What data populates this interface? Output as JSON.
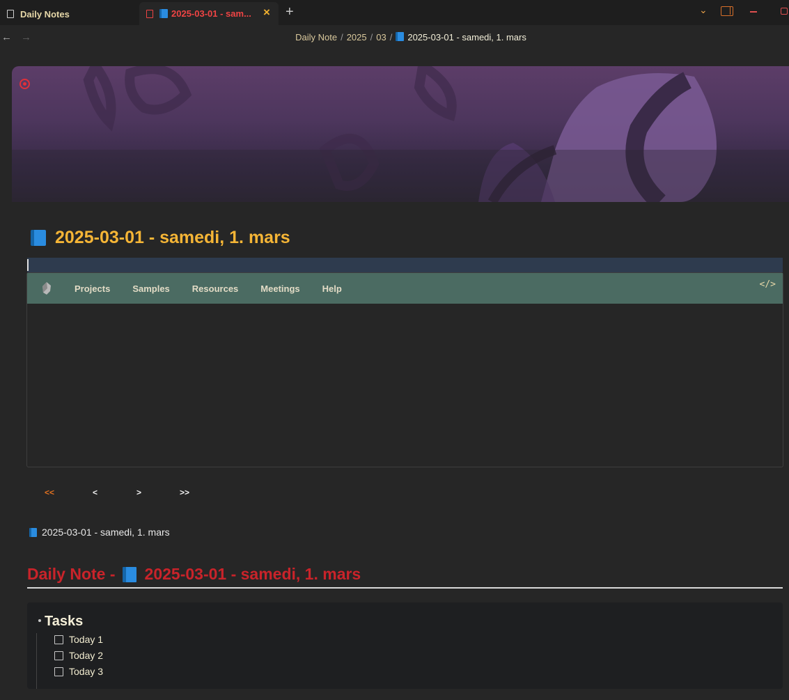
{
  "tabs": [
    {
      "label": "Daily Notes"
    },
    {
      "label": "2025-03-01 - sam..."
    }
  ],
  "breadcrumb": {
    "items": [
      "Daily Note",
      "2025",
      "03"
    ],
    "current": "2025-03-01 - samedi, 1. mars"
  },
  "page": {
    "title": "2025-03-01 - samedi, 1. mars"
  },
  "menu": {
    "items": [
      "Projects",
      "Samples",
      "Resources",
      "Meetings",
      "Help"
    ],
    "code_toggle": "</>"
  },
  "pager": {
    "first": "<<",
    "prev": "<",
    "next": ">",
    "last": ">>"
  },
  "note_title": "2025-03-01 - samedi, 1. mars",
  "heading": {
    "prefix": "Daily Note - ",
    "title": "2025-03-01 - samedi, 1. mars"
  },
  "tasks": {
    "heading": "Tasks",
    "items": [
      {
        "label": "Today 1",
        "checked": false
      },
      {
        "label": "Today 2",
        "checked": false
      },
      {
        "label": "Today 3",
        "checked": false
      }
    ]
  },
  "colors": {
    "title": "#f5b536",
    "heading": "#c9232a",
    "menu_bar": "#4b6b62",
    "active_tab": "#ef4444"
  }
}
